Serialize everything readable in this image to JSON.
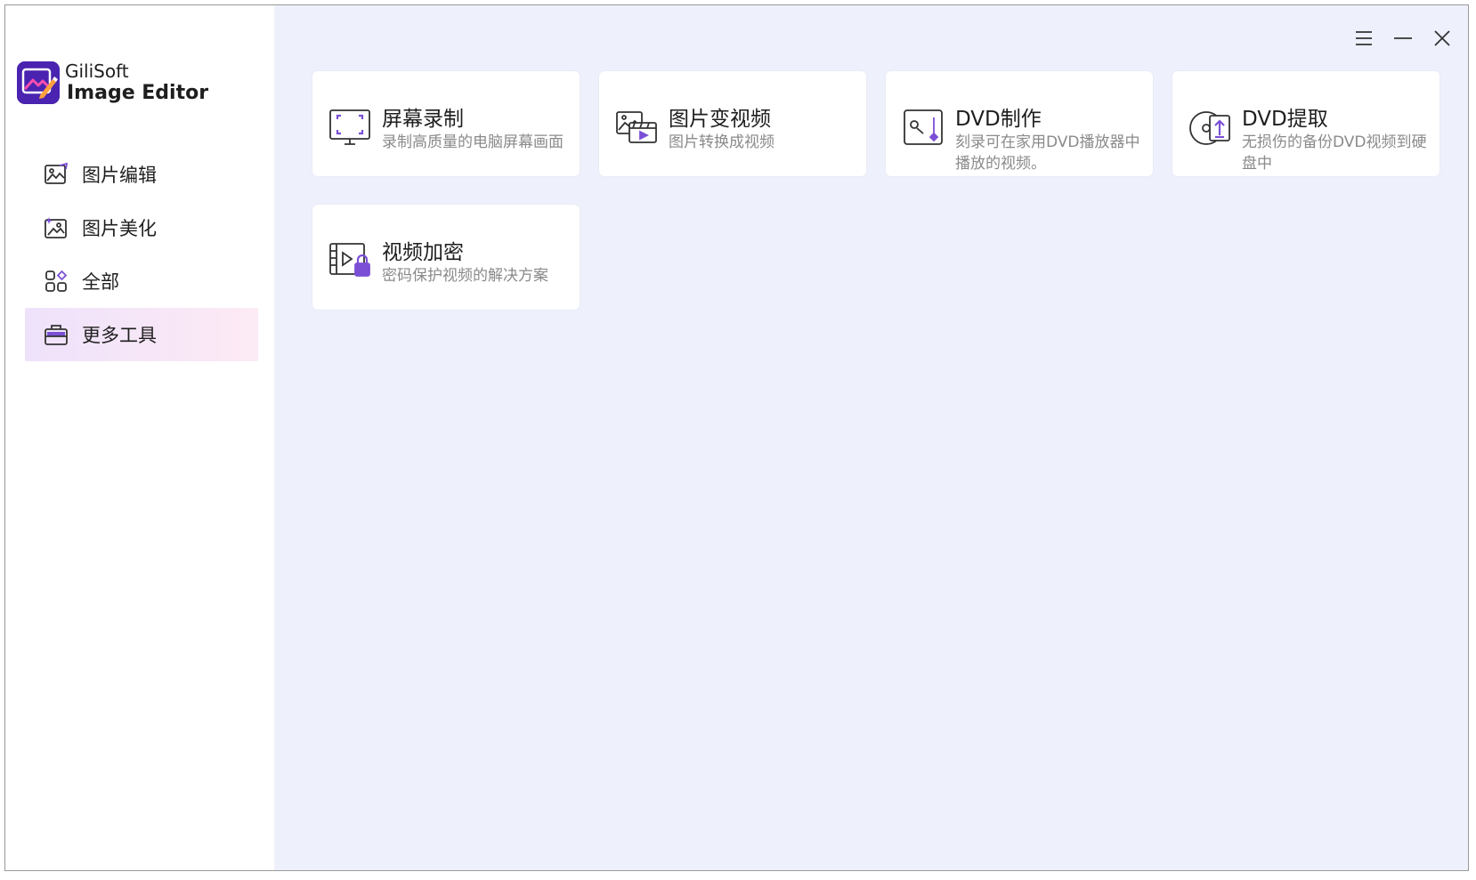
{
  "app": {
    "brand_name": "GiliSoft",
    "product_name": "Image Editor"
  },
  "window_controls": [
    {
      "name": "menu-icon"
    },
    {
      "name": "minimize-icon"
    },
    {
      "name": "close-icon"
    }
  ],
  "sidebar": {
    "items": [
      {
        "label": "图片编辑",
        "icon": "image-edit-icon",
        "active": false
      },
      {
        "label": "图片美化",
        "icon": "image-beautify-icon",
        "active": false
      },
      {
        "label": "全部",
        "icon": "all-apps-icon",
        "active": false
      },
      {
        "label": "更多工具",
        "icon": "toolbox-icon",
        "active": true
      }
    ]
  },
  "tools": [
    {
      "title": "屏幕录制",
      "desc": "录制高质量的电脑屏幕画面",
      "icon": "screen-record-icon"
    },
    {
      "title": "图片变视频",
      "desc": "图片转换成视频",
      "icon": "image-to-video-icon"
    },
    {
      "title": "DVD制作",
      "desc": "刻录可在家用DVD播放器中播放的视频。",
      "icon": "dvd-burn-icon"
    },
    {
      "title": "DVD提取",
      "desc": "无损伤的备份DVD视频到硬盘中",
      "icon": "dvd-extract-icon"
    },
    {
      "title": "视频加密",
      "desc": "密码保护视频的解决方案",
      "icon": "video-encrypt-icon"
    }
  ],
  "colors": {
    "accent": "#7b4fd6",
    "main_bg": "#eef1fb",
    "active_item_bg": "#f3e6f8"
  }
}
